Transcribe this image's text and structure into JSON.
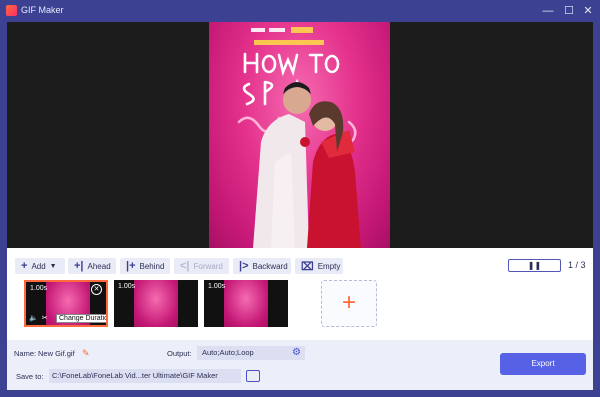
{
  "window": {
    "title": "GIF Maker",
    "controls": {
      "minimize": "—",
      "maximize": "☐",
      "close": "✕"
    }
  },
  "toolbar": {
    "add": "Add",
    "ahead": "Ahead",
    "behind": "Behind",
    "forward": "Forward",
    "backward": "Backward",
    "empty": "Empty",
    "pause_symbol": "❚❚",
    "page_counter": "1 / 3"
  },
  "frames": [
    {
      "duration": "1.00s",
      "selected": true,
      "tooltip": "Change Duration"
    },
    {
      "duration": "1.00s",
      "selected": false
    },
    {
      "duration": "1.00s",
      "selected": false
    }
  ],
  "add_frame_symbol": "+",
  "footer": {
    "name_label": "Name:",
    "name_value": "New Gif.gif",
    "output_label": "Output:",
    "output_value": "Auto;Auto;Loop",
    "saveto_label": "Save to:",
    "saveto_value": "C:\\FoneLab\\FoneLab Vid...ter Ultimate\\GIF Maker",
    "export_label": "Export"
  },
  "colors": {
    "accent": "#5661e6",
    "orange": "#ff6a3d",
    "titlebar": "#3c4191"
  }
}
